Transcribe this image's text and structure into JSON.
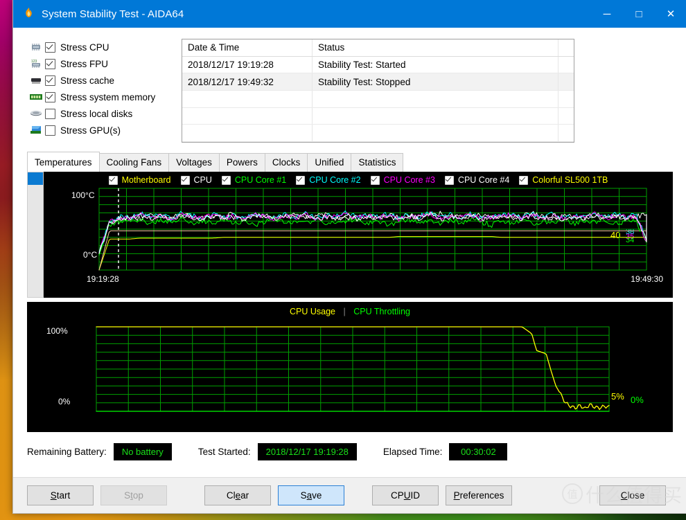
{
  "window": {
    "title": "System Stability Test - AIDA64",
    "app_icon": "flame-icon",
    "minimize_label": "─",
    "maximize_label": "□",
    "close_label": "✕",
    "titlebar_color": "#0078d7"
  },
  "stress_options": [
    {
      "label": "Stress CPU",
      "checked": true,
      "icon": "cpu-chip-icon"
    },
    {
      "label": "Stress FPU",
      "checked": true,
      "icon": "fpu-chip-icon"
    },
    {
      "label": "Stress cache",
      "checked": true,
      "icon": "cache-chip-icon"
    },
    {
      "label": "Stress system memory",
      "checked": true,
      "icon": "memory-module-icon"
    },
    {
      "label": "Stress local disks",
      "checked": false,
      "icon": "hard-disk-icon"
    },
    {
      "label": "Stress GPU(s)",
      "checked": false,
      "icon": "gpu-card-icon"
    }
  ],
  "log": {
    "columns": [
      "Date & Time",
      "Status"
    ],
    "rows": [
      {
        "datetime": "2018/12/17 19:19:28",
        "status": "Stability Test: Started"
      },
      {
        "datetime": "2018/12/17 19:49:32",
        "status": "Stability Test: Stopped"
      },
      {
        "datetime": "",
        "status": ""
      },
      {
        "datetime": "",
        "status": ""
      },
      {
        "datetime": "",
        "status": ""
      }
    ]
  },
  "tabs": [
    {
      "label": "Temperatures",
      "active": true
    },
    {
      "label": "Cooling Fans",
      "active": false
    },
    {
      "label": "Voltages",
      "active": false
    },
    {
      "label": "Powers",
      "active": false
    },
    {
      "label": "Clocks",
      "active": false
    },
    {
      "label": "Unified",
      "active": false
    },
    {
      "label": "Statistics",
      "active": false
    }
  ],
  "chart_data": [
    {
      "type": "line",
      "title": "Temperatures",
      "ylabel": "",
      "xlabel": "",
      "ylim": [
        0,
        100
      ],
      "y_top_label": "100°C",
      "y_bottom_label": "0°C",
      "x_start_label": "19:19:28",
      "x_end_label": "19:49:30",
      "grid": true,
      "grid_color": "#00a000",
      "background": "#000000",
      "legend_position": "top",
      "legend": [
        {
          "name": "Motherboard",
          "color": "#ffff00",
          "checked": true
        },
        {
          "name": "CPU",
          "color": "#ffffff",
          "checked": true
        },
        {
          "name": "CPU Core #1",
          "color": "#00ff00",
          "checked": true
        },
        {
          "name": "CPU Core #2",
          "color": "#00ffff",
          "checked": true
        },
        {
          "name": "CPU Core #3",
          "color": "#ff00ff",
          "checked": true
        },
        {
          "name": "CPU Core #4",
          "color": "#ffffff",
          "checked": true
        },
        {
          "name": "Colorful SL500 1TB",
          "color": "#ffff00",
          "checked": true
        }
      ],
      "current_value_labels": [
        {
          "text": "40",
          "color": "#ffff00"
        },
        {
          "text": "38",
          "color": "#00ffff"
        },
        {
          "text": "35",
          "color": "#ff00ff"
        },
        {
          "text": "34",
          "color": "#00ff00"
        }
      ],
      "series": [
        {
          "name": "Motherboard",
          "color": "#ffff00",
          "approx_value": 40,
          "values": [
            0,
            38,
            38,
            38,
            39,
            39,
            39,
            39,
            39,
            39,
            39,
            39,
            40,
            40,
            40,
            40,
            40,
            40,
            40,
            40,
            40,
            40,
            40,
            40,
            40,
            40,
            40,
            40,
            40,
            41,
            41,
            41,
            41,
            41,
            41,
            41,
            41,
            41,
            41,
            40,
            40,
            40,
            40,
            40,
            40,
            40,
            40,
            40,
            40,
            40,
            40,
            40,
            40,
            40
          ]
        },
        {
          "name": "Colorful SL500 1TB",
          "color": "#f7cba0",
          "approx_value": 48,
          "values": [
            0,
            48,
            48,
            48,
            48,
            48,
            48,
            48,
            48,
            48,
            48,
            48,
            48,
            48,
            48,
            48,
            48,
            48,
            48,
            48,
            48,
            48,
            48,
            48,
            48,
            48,
            48,
            48,
            48,
            48,
            48,
            48,
            48,
            48,
            48,
            48,
            48,
            48,
            48,
            48,
            48,
            48,
            48,
            48,
            48,
            48,
            48,
            48,
            48,
            48,
            48,
            48,
            48,
            48
          ]
        },
        {
          "name": "CPU",
          "color": "#ffffff",
          "approx_value": 65,
          "values": [
            20,
            58,
            64,
            66,
            63,
            67,
            65,
            64,
            68,
            66,
            63,
            67,
            65,
            69,
            64,
            66,
            68,
            63,
            65,
            67,
            64,
            66,
            68,
            65,
            63,
            67,
            66,
            64,
            68,
            65,
            67,
            63,
            66,
            69,
            64,
            66,
            65,
            68,
            63,
            67,
            64,
            66,
            69,
            65,
            63,
            67,
            66,
            64,
            68,
            65,
            67,
            64,
            66,
            68
          ]
        },
        {
          "name": "CPU Core #1",
          "color": "#00ff00",
          "approx_value": 34,
          "values": [
            18,
            54,
            60,
            58,
            62,
            57,
            61,
            59,
            63,
            56,
            60,
            58,
            62,
            57,
            61,
            55,
            59,
            63,
            57,
            61,
            58,
            62,
            56,
            60,
            59,
            63,
            57,
            61,
            55,
            59,
            62,
            58,
            60,
            56,
            61,
            57,
            63,
            59,
            55,
            61,
            58,
            62,
            56,
            60,
            59,
            63,
            57,
            61,
            58,
            62,
            56,
            60,
            59,
            34
          ]
        },
        {
          "name": "CPU Core #2",
          "color": "#00ffff",
          "approx_value": 38,
          "values": [
            22,
            60,
            66,
            64,
            69,
            65,
            68,
            63,
            70,
            66,
            64,
            69,
            65,
            67,
            63,
            70,
            66,
            64,
            68,
            65,
            69,
            63,
            67,
            66,
            70,
            64,
            68,
            65,
            69,
            63,
            67,
            66,
            70,
            64,
            68,
            65,
            69,
            63,
            67,
            66,
            70,
            64,
            68,
            65,
            69,
            63,
            67,
            66,
            70,
            64,
            68,
            65,
            67,
            38
          ]
        },
        {
          "name": "CPU Core #3",
          "color": "#ff00ff",
          "approx_value": 35,
          "values": [
            21,
            59,
            65,
            63,
            68,
            64,
            67,
            62,
            69,
            65,
            63,
            68,
            64,
            66,
            62,
            69,
            65,
            63,
            67,
            64,
            68,
            62,
            66,
            65,
            69,
            63,
            67,
            64,
            68,
            62,
            66,
            65,
            69,
            63,
            67,
            64,
            68,
            62,
            66,
            65,
            69,
            63,
            67,
            64,
            68,
            62,
            66,
            65,
            69,
            63,
            67,
            64,
            66,
            35
          ]
        },
        {
          "name": "CPU Core #4",
          "color": "#ffffff",
          "approx_value": 35,
          "values": [
            20,
            58,
            64,
            62,
            67,
            63,
            66,
            61,
            68,
            64,
            62,
            67,
            63,
            65,
            61,
            68,
            64,
            62,
            66,
            63,
            67,
            61,
            65,
            64,
            68,
            62,
            66,
            63,
            67,
            61,
            65,
            64,
            68,
            62,
            66,
            63,
            67,
            61,
            65,
            64,
            68,
            62,
            66,
            63,
            67,
            61,
            65,
            64,
            68,
            62,
            66,
            63,
            65,
            35
          ]
        }
      ]
    },
    {
      "type": "line",
      "title": "CPU Usage / CPU Throttling",
      "ylim": [
        0,
        100
      ],
      "y_top_label": "100%",
      "y_bottom_label": "0%",
      "grid": true,
      "grid_color": "#00a000",
      "background": "#000000",
      "legend_position": "top",
      "legend": [
        {
          "name": "CPU Usage",
          "color": "#ffff00"
        },
        {
          "name": "CPU Throttling",
          "color": "#00ff00"
        }
      ],
      "separator": "|",
      "current_value_labels": [
        {
          "text": "5%",
          "color": "#ffff00"
        },
        {
          "text": "0%",
          "color": "#00ff00"
        }
      ],
      "series": [
        {
          "name": "CPU Usage",
          "color": "#ffff00",
          "approx_value": 5,
          "values": [
            100,
            100,
            100,
            100,
            100,
            100,
            100,
            100,
            100,
            100,
            100,
            100,
            100,
            100,
            100,
            100,
            100,
            100,
            100,
            100,
            100,
            100,
            100,
            100,
            100,
            100,
            100,
            100,
            100,
            100,
            100,
            100,
            100,
            100,
            100,
            100,
            100,
            100,
            100,
            100,
            100,
            100,
            100,
            100,
            100,
            100,
            100,
            100,
            100,
            100,
            100,
            100,
            100,
            100,
            100,
            100,
            100,
            100,
            100,
            100,
            100,
            100,
            100,
            100,
            100,
            100,
            100,
            100,
            100,
            100,
            100,
            100,
            100,
            100,
            100,
            100,
            100,
            100,
            100,
            100,
            100,
            100,
            100,
            100,
            100,
            100,
            100,
            100,
            100,
            96,
            92,
            72,
            70,
            68,
            48,
            30,
            20,
            10,
            6,
            4,
            7,
            3,
            8,
            5,
            4,
            6,
            5
          ]
        },
        {
          "name": "CPU Throttling",
          "color": "#00ff00",
          "approx_value": 0,
          "values": [
            0,
            0,
            0,
            0,
            0,
            0,
            0,
            0,
            0,
            0,
            0,
            0,
            0,
            0,
            0,
            0,
            0,
            0,
            0,
            0,
            0,
            0,
            0,
            0,
            0,
            0,
            0,
            0,
            0,
            0,
            0,
            0,
            0,
            0,
            0,
            0,
            0,
            0,
            0,
            0,
            0,
            0,
            0,
            0,
            0,
            0,
            0,
            0,
            0,
            0,
            0,
            0,
            0,
            0,
            0,
            0,
            0,
            0,
            0,
            0,
            0,
            0,
            0,
            0,
            0,
            0,
            0,
            0,
            0,
            0,
            0,
            0,
            0,
            0,
            0,
            0,
            0,
            0,
            0,
            0,
            0,
            0,
            0,
            0,
            0,
            0,
            0,
            0,
            0,
            0,
            0,
            0,
            0,
            0,
            0,
            0,
            0,
            0,
            0,
            0,
            0,
            0,
            0,
            0,
            0,
            0,
            0
          ]
        }
      ]
    }
  ],
  "status": {
    "battery_label": "Remaining Battery:",
    "battery_value": "No battery",
    "started_label": "Test Started:",
    "started_value": "2018/12/17 19:19:28",
    "elapsed_label": "Elapsed Time:",
    "elapsed_value": "00:30:02",
    "value_color": "#19e019"
  },
  "buttons": [
    {
      "name": "start",
      "label": "Start",
      "mnemonic_index": 0,
      "state": "normal"
    },
    {
      "name": "stop",
      "label": "Stop",
      "mnemonic_index": 1,
      "state": "disabled"
    },
    {
      "name": "clear",
      "label": "Clear",
      "mnemonic_index": 2,
      "state": "normal"
    },
    {
      "name": "save",
      "label": "Save",
      "mnemonic_index": 1,
      "state": "focused"
    },
    {
      "name": "cpuid",
      "label": "CPUID",
      "mnemonic_index": 2,
      "state": "normal"
    },
    {
      "name": "preferences",
      "label": "Preferences",
      "mnemonic_index": 0,
      "state": "normal"
    },
    {
      "name": "close",
      "label": "Close",
      "mnemonic_index": 0,
      "state": "normal"
    }
  ],
  "watermark": {
    "mark": "值",
    "text": "什么值得买"
  }
}
